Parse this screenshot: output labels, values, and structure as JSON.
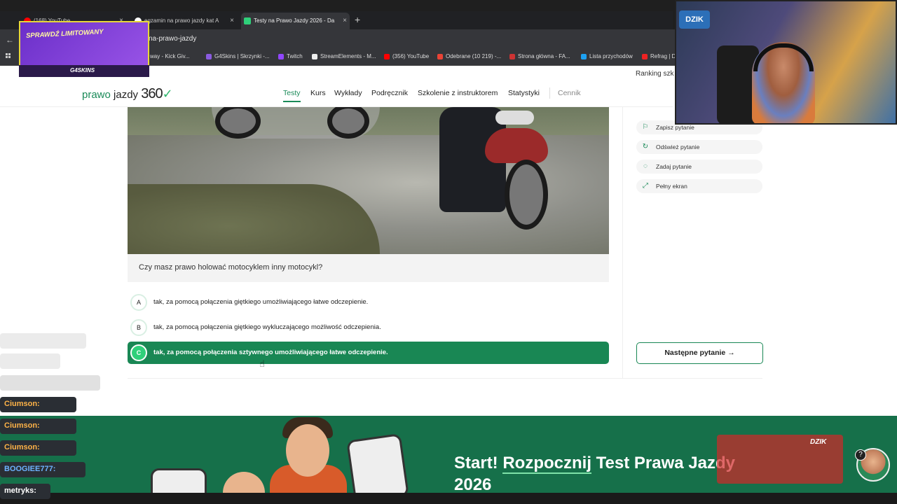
{
  "browser": {
    "tabs": [
      {
        "title": "(168) YouTube",
        "icon": "youtube-icon"
      },
      {
        "title": "egzamin na prawo jazdy kat A",
        "icon": "google-icon"
      },
      {
        "title": "Testy na Prawo Jazdy 2026 - Da",
        "icon": "site-icon"
      }
    ],
    "url": "na-prawo-jazdy",
    "bookmarks": [
      {
        "label": "way - Kick Giv...",
        "color": "#333"
      },
      {
        "label": "G4Skins | Skrzynki -...",
        "color": "#8a5be0"
      },
      {
        "label": "Twitch",
        "color": "#9146ff"
      },
      {
        "label": "StreamElements - M...",
        "color": "#eee"
      },
      {
        "label": "(356) YouTube",
        "color": "#ff0000"
      },
      {
        "label": "Odebrane (10 219) -...",
        "color": "#ea4335"
      },
      {
        "label": "Strona główna - FA...",
        "color": "#c33"
      },
      {
        "label": "Lista przychodów",
        "color": "#1da1f2"
      },
      {
        "label": "Refrag | D",
        "color": "#e22"
      }
    ]
  },
  "site": {
    "ranking": "Ranking szk",
    "logo_a": "prawo",
    "logo_b": " jazdy ",
    "logo_n": "360",
    "logo_check": "✓",
    "nav": [
      "Testy",
      "Kurs",
      "Wykłady",
      "Podręcznik",
      "Szkolenie z instruktorem",
      "Statystyki",
      "Cennik"
    ]
  },
  "quiz": {
    "question": "Czy masz prawo holować motocyklem inny motocykl?",
    "answers": [
      {
        "letter": "A",
        "text": "tak, za pomocą połączenia giętkiego umożliwiającego łatwe odczepienie."
      },
      {
        "letter": "B",
        "text": "tak, za pomocą połączenia giętkiego wykluczającego możliwość odczepienia."
      },
      {
        "letter": "C",
        "text": "tak, za pomocą połączenia sztywnego umożliwiającego łatwe odczepienie."
      }
    ],
    "selected": "C"
  },
  "sidebar": {
    "actions": [
      {
        "label": "Zapisz pytanie",
        "icon": "bookmark-icon"
      },
      {
        "label": "Odśwież pytanie",
        "icon": "refresh-icon"
      },
      {
        "label": "Zadaj pytanie",
        "icon": "chat-icon"
      },
      {
        "label": "Pełny ekran",
        "icon": "fullscreen-icon"
      }
    ],
    "next_label": "Następne pytanie",
    "next_arrow": "→"
  },
  "banner": {
    "title_pre": "Start! ",
    "title_u": "Rozpocznij",
    "title_post": " Test Prawa Jazdy",
    "title_year": "2026"
  },
  "overlay": {
    "promo_text": "SPRAWDŹ LIMITOWANY",
    "promo_brand": "G4SKINS",
    "webcam_logo": "DZIK",
    "ad_label": "DZIK",
    "chat": [
      {
        "text": "Ciumson:",
        "style": "dark"
      },
      {
        "text": "Ciumson:",
        "style": "dark"
      },
      {
        "text": "Ciumson:",
        "style": "dark"
      },
      {
        "text": "BOOGIEE777:",
        "style": "blue"
      },
      {
        "text": "metryks:",
        "style": "white"
      }
    ],
    "help": "?"
  },
  "colors": {
    "brand_green": "#198754",
    "banner_green": "#16704a"
  }
}
